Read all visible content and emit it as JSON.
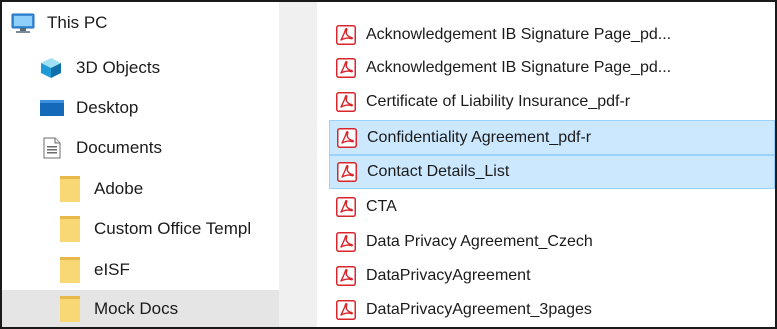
{
  "nav": {
    "items": [
      {
        "label": "This PC",
        "icon": "this-pc-icon"
      },
      {
        "label": "3D Objects",
        "icon": "3d-objects-icon"
      },
      {
        "label": "Desktop",
        "icon": "desktop-icon"
      },
      {
        "label": "Documents",
        "icon": "documents-icon"
      },
      {
        "label": "Adobe",
        "icon": "folder-icon"
      },
      {
        "label": "Custom Office Templ",
        "icon": "folder-icon"
      },
      {
        "label": "eISF",
        "icon": "folder-icon"
      },
      {
        "label": "Mock Docs",
        "icon": "folder-icon",
        "selected": true
      }
    ]
  },
  "files": {
    "items": [
      {
        "label": "Acknowledgement IB Signature Page_pd...",
        "icon": "pdf-icon"
      },
      {
        "label": "Acknowledgement IB Signature Page_pd...",
        "icon": "pdf-icon"
      },
      {
        "label": "Certificate of Liability Insurance_pdf-r",
        "icon": "pdf-icon"
      },
      {
        "label": "Confidentiality Agreement_pdf-r",
        "icon": "pdf-icon",
        "selected": true
      },
      {
        "label": "Contact Details_List",
        "icon": "pdf-icon",
        "selected": true
      },
      {
        "label": "CTA",
        "icon": "pdf-icon"
      },
      {
        "label": "Data Privacy Agreement_Czech",
        "icon": "pdf-icon"
      },
      {
        "label": "DataPrivacyAgreement",
        "icon": "pdf-icon"
      },
      {
        "label": "DataPrivacyAgreement_3pages",
        "icon": "pdf-icon"
      }
    ]
  },
  "colors": {
    "selection_fill": "#cce8ff",
    "selection_border": "#99d1ff",
    "nav_selected": "#e5e5e5",
    "pdf_red": "#d9262c",
    "folder_yellow": "#f8d775"
  }
}
